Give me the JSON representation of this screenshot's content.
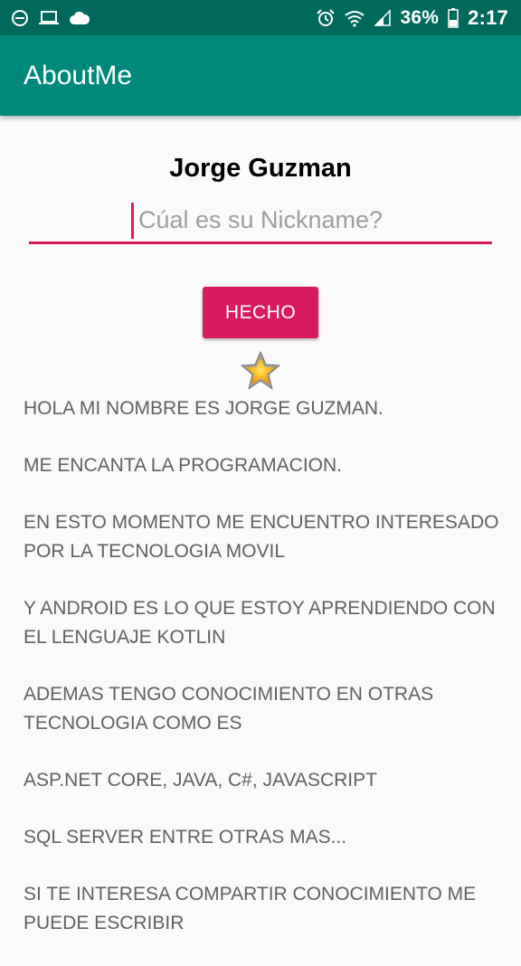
{
  "status_bar": {
    "battery_percent": "36%",
    "time": "2:17",
    "icons": [
      "minus-circle-icon",
      "laptop-icon",
      "cloud-icon",
      "alarm-icon",
      "wifi-icon",
      "signal-icon",
      "battery-icon"
    ]
  },
  "app_bar": {
    "title": "AboutMe"
  },
  "profile": {
    "name": "Jorge Guzman"
  },
  "nickname_input": {
    "placeholder": "Cúal es su Nickname?",
    "value": ""
  },
  "done_button": {
    "label": "HECHO"
  },
  "star": {
    "icon": "star-icon"
  },
  "bio": {
    "paragraphs": [
      "HOLA MI NOMBRE ES JORGE GUZMAN.",
      "ME ENCANTA LA PROGRAMACION.",
      "EN ESTO MOMENTO ME ENCUENTRO INTERESADO POR LA TECNOLOGIA MOVIL",
      "Y ANDROID ES LO QUE ESTOY APRENDIENDO CON EL LENGUAJE KOTLIN",
      "ADEMAS TENGO CONOCIMIENTO EN OTRAS TECNOLOGIA COMO ES",
      "ASP.NET CORE, JAVA, C#, JAVASCRIPT",
      "SQL SERVER ENTRE OTRAS MAS...",
      "SI TE INTERESA COMPARTIR CONOCIMIENTO ME PUEDE ESCRIBIR"
    ]
  },
  "colors": {
    "status_bar": "#00695c",
    "app_bar": "#00897b",
    "accent": "#d81b60",
    "background": "#fafafa"
  }
}
